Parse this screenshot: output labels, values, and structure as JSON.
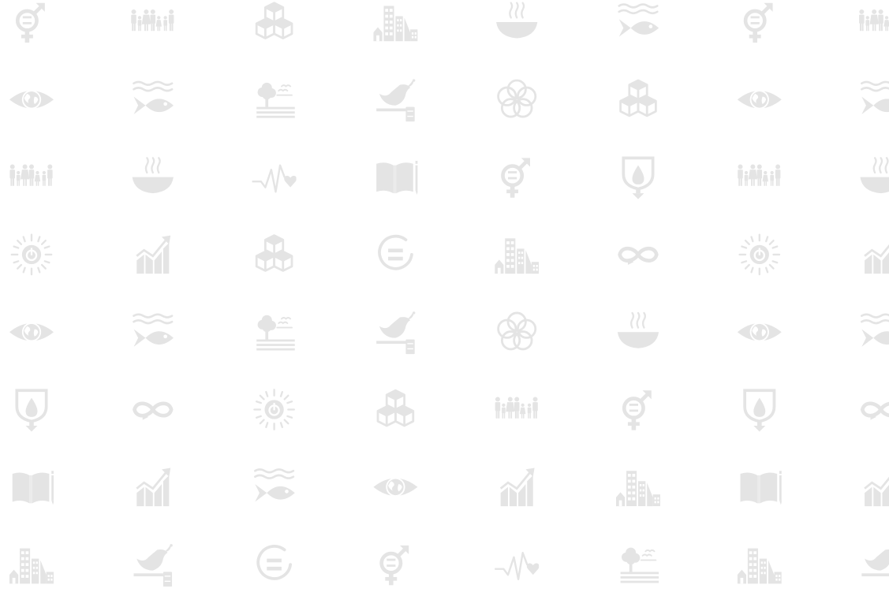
{
  "background": "#ffffff",
  "icon_color": "#e4e4e4",
  "pattern": [
    [
      "gender-equality-icon",
      "family-icon",
      "cubes-icon",
      "city-icon",
      "bowl-icon",
      "fish-icon",
      "gender-equality-icon",
      "family-icon"
    ],
    [
      "eye-globe-icon",
      "fish-icon",
      "tree-landscape-icon",
      "dove-gavel-icon",
      "flower-rings-icon",
      "cubes-icon",
      "eye-globe-icon",
      "fish-icon"
    ],
    [
      "family-icon",
      "bowl-icon",
      "heartbeat-icon",
      "book-pencil-icon",
      "gender-equality-icon",
      "water-drop-icon",
      "family-icon",
      "bowl-icon"
    ],
    [
      "sun-power-icon",
      "growth-chart-icon",
      "cubes-icon",
      "equals-circle-icon",
      "city-icon",
      "infinity-icon",
      "sun-power-icon",
      "growth-chart-icon"
    ],
    [
      "eye-globe-icon",
      "fish-icon",
      "tree-landscape-icon",
      "dove-gavel-icon",
      "flower-rings-icon",
      "bowl-icon",
      "eye-globe-icon",
      "fish-icon"
    ],
    [
      "water-drop-icon",
      "infinity-icon",
      "sun-power-icon",
      "cubes-icon",
      "family-icon",
      "gender-equality-icon",
      "water-drop-icon",
      "infinity-icon"
    ],
    [
      "book-pencil-icon",
      "growth-chart-icon",
      "fish-icon",
      "eye-globe-icon",
      "growth-chart-icon",
      "city-icon",
      "book-pencil-icon",
      "growth-chart-icon"
    ],
    [
      "city-icon",
      "dove-gavel-icon",
      "equals-circle-icon",
      "gender-equality-icon",
      "heartbeat-icon",
      "tree-landscape-icon",
      "city-icon",
      "dove-gavel-icon"
    ]
  ]
}
